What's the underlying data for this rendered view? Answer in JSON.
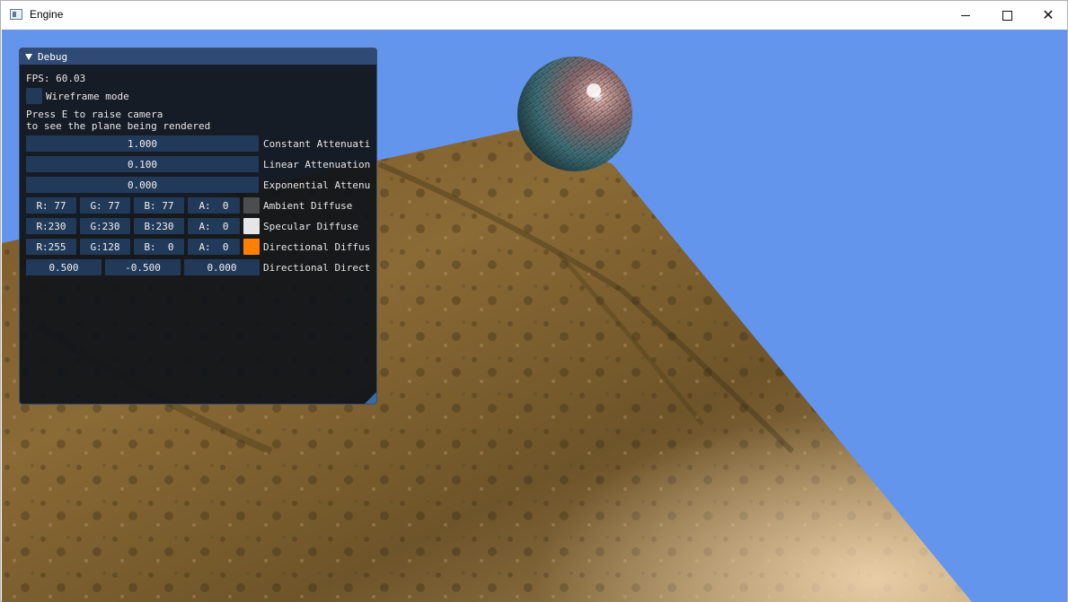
{
  "window": {
    "title": "Engine",
    "controls": {
      "minimize": "minimize-icon",
      "maximize": "maximize-icon",
      "close": "✕"
    }
  },
  "viewport": {
    "sky_color": "#6495ed",
    "ground_texture": "rocky-dirt",
    "sphere_texture": "tiled-stone"
  },
  "debug": {
    "title": "Debug",
    "fps": "FPS: 60.03",
    "wireframe_label": "Wireframe mode",
    "wireframe_checked": false,
    "hint_line1": "Press E to raise camera",
    "hint_line2": "to see the plane being rendered",
    "constant_attenuation": {
      "value": "1.000",
      "label": "Constant Attenuati"
    },
    "linear_attenuation": {
      "value": "0.100",
      "label": "Linear Attenuation"
    },
    "exponential_attenuation": {
      "value": "0.000",
      "label": "Exponential Attenu"
    },
    "ambient": {
      "r": "R: 77",
      "g": "G: 77",
      "b": "B: 77",
      "a": "A:  0",
      "color": "#4d4d4d",
      "label": "Ambient Diffuse"
    },
    "specular": {
      "r": "R:230",
      "g": "G:230",
      "b": "B:230",
      "a": "A:  0",
      "color": "#e6e6e6",
      "label": "Specular Diffuse"
    },
    "directional": {
      "r": "R:255",
      "g": "G:128",
      "b": "B:  0",
      "a": "A:  0",
      "color": "#ff8000",
      "label": "Directional Diffus"
    },
    "direction": {
      "x": "0.500",
      "y": "-0.500",
      "z": "0.000",
      "label": "Directional Direct"
    }
  }
}
